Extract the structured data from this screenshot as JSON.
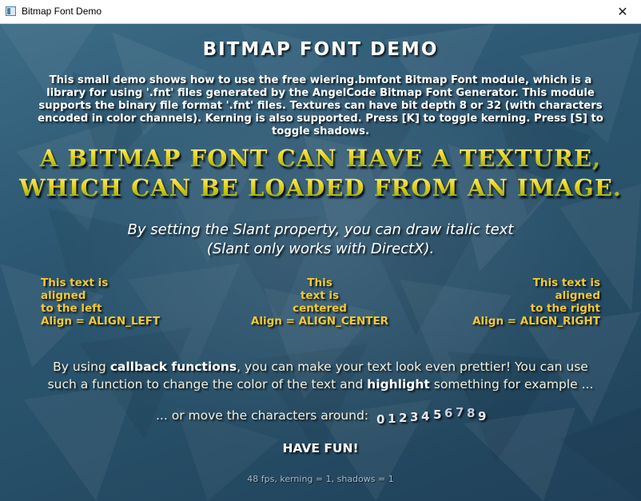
{
  "window": {
    "title": "Bitmap Font Demo",
    "close_glyph": "✕",
    "icon": "app-window-icon"
  },
  "demo": {
    "title": "BITMAP FONT DEMO",
    "intro": "This small demo shows how to use the free wiering.bmfont Bitmap Font module, which is a library for using '.fnt' files generated by the AngelCode Bitmap Font Generator. This module supports the binary file format '.fnt' files. Textures can have bit depth 8 or 32 (with characters encoded in color channels). Kerning is also supported. Press [K] to toggle kerning. Press [S] to toggle shadows.",
    "banner_line1": "A BITMAP FONT CAN HAVE A TEXTURE,",
    "banner_line2": "WHICH CAN BE LOADED FROM AN IMAGE.",
    "slant_line1": "By setting the Slant property, you can draw italic text",
    "slant_line2": "(Slant only works with DirectX).",
    "align_left": [
      "This text is",
      "aligned",
      "to the left",
      "Align = ALIGN_LEFT"
    ],
    "align_center": [
      "This",
      "text is",
      "centered",
      "Align = ALIGN_CENTER"
    ],
    "align_right": [
      "This text is",
      "aligned",
      "to the right",
      "Align = ALIGN_RIGHT"
    ],
    "callback_line1_a": "By using ",
    "callback_line1_hl": "callback functions",
    "callback_line1_b": ", you can make your text look even prettier! You can use",
    "callback_line2_a": "such a function to change the color of the text and ",
    "callback_line2_hl": "highlight",
    "callback_line2_b": " something for example ...",
    "move_text": "... or move the characters around:",
    "digits": [
      "0",
      "1",
      "2",
      "3",
      "4",
      "5",
      "6",
      "7",
      "8",
      "9"
    ],
    "have_fun": "HAVE FUN!",
    "status": "48 fps, kerning = 1, shadows = 1"
  },
  "colors": {
    "background": "#2c5671",
    "banner_gold": "#e6d21a",
    "align_text": "#f3c832"
  }
}
